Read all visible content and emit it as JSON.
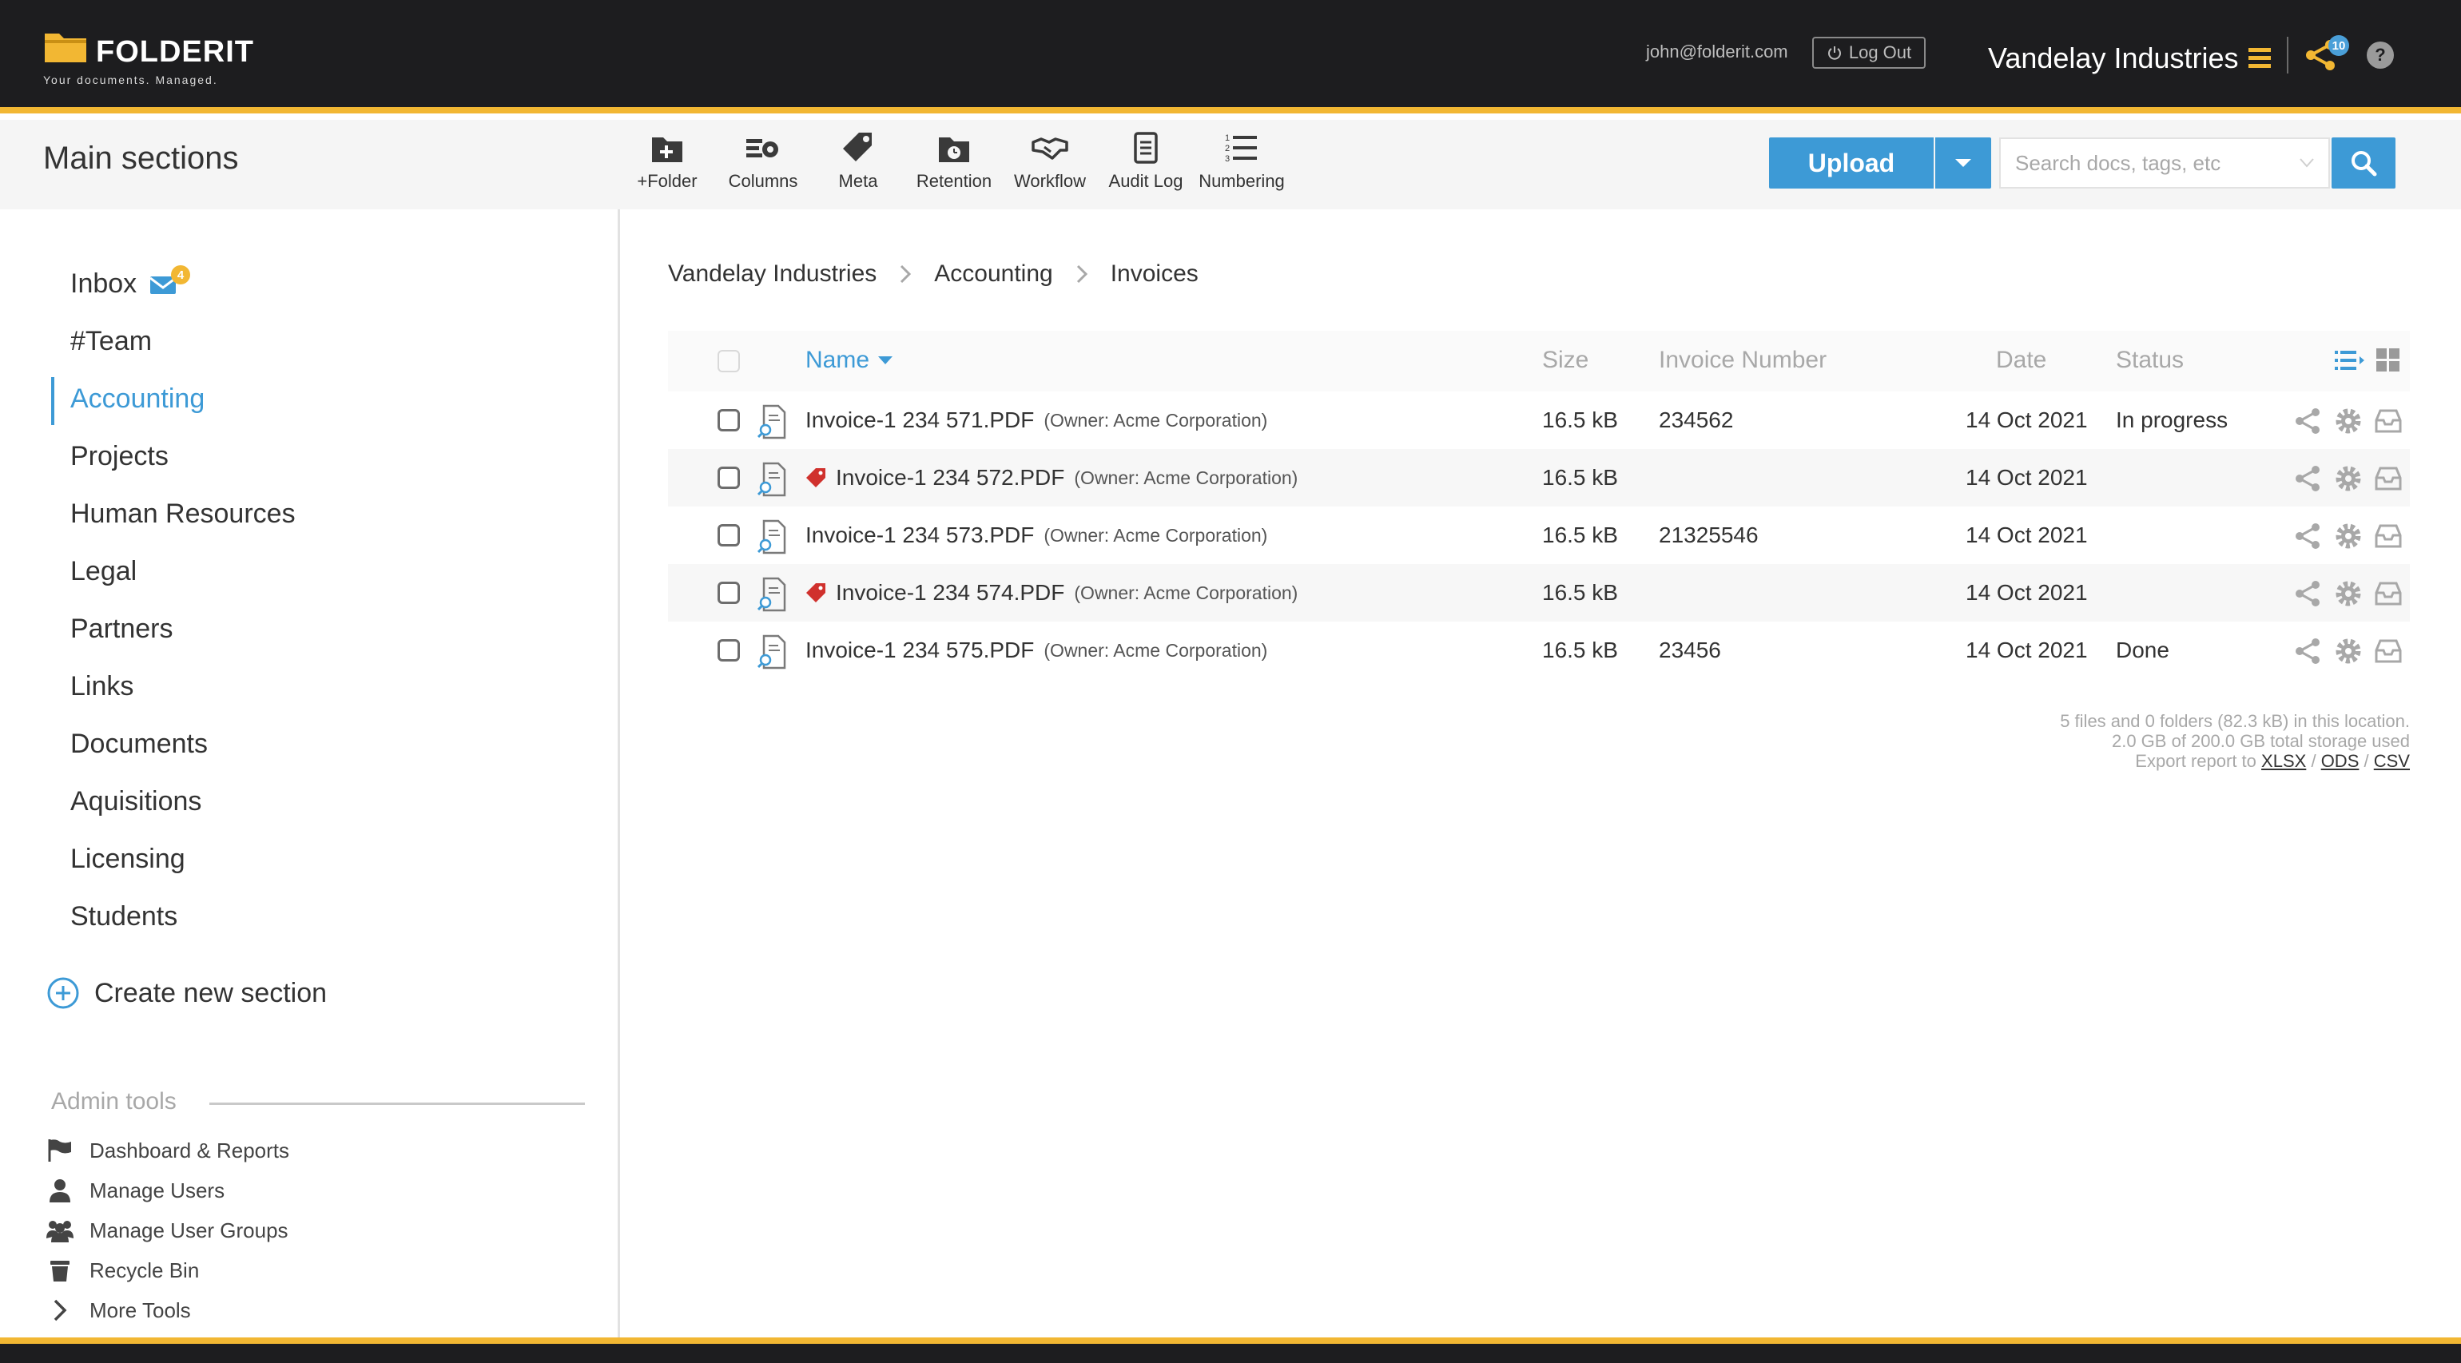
{
  "header": {
    "brand": "FOLDERIT",
    "tagline": "Your documents. Managed.",
    "user_email": "john@folderit.com",
    "logout_label": "Log Out",
    "organization": "Vandelay Industries",
    "share_badge": "10",
    "help_label": "?"
  },
  "toolbar": {
    "section_title": "Main sections",
    "tools": [
      {
        "label": "+Folder",
        "icon": "add-folder-icon"
      },
      {
        "label": "Columns",
        "icon": "columns-settings-icon"
      },
      {
        "label": "Meta",
        "icon": "tag-icon"
      },
      {
        "label": "Retention",
        "icon": "retention-clock-icon"
      },
      {
        "label": "Workflow",
        "icon": "handshake-icon"
      },
      {
        "label": "Audit Log",
        "icon": "audit-log-icon"
      },
      {
        "label": "Numbering",
        "icon": "numbered-list-icon"
      }
    ],
    "upload_label": "Upload",
    "search_placeholder": "Search docs, tags, etc"
  },
  "sidebar": {
    "items": [
      {
        "label": "Inbox",
        "badge": "4"
      },
      {
        "label": "#Team"
      },
      {
        "label": "Accounting",
        "active": true
      },
      {
        "label": "Projects"
      },
      {
        "label": "Human Resources"
      },
      {
        "label": "Legal"
      },
      {
        "label": "Partners"
      },
      {
        "label": "Links"
      },
      {
        "label": "Documents"
      },
      {
        "label": "Aquisitions"
      },
      {
        "label": "Licensing"
      },
      {
        "label": "Students"
      }
    ],
    "create_label": "Create new section",
    "admin_title": "Admin tools",
    "admin_items": [
      {
        "label": "Dashboard & Reports",
        "icon": "flag-icon"
      },
      {
        "label": "Manage Users",
        "icon": "user-icon"
      },
      {
        "label": "Manage User Groups",
        "icon": "user-group-icon"
      },
      {
        "label": "Recycle Bin",
        "icon": "recycle-bin-icon"
      },
      {
        "label": "More Tools",
        "icon": "chevron-right-icon"
      }
    ]
  },
  "breadcrumb": [
    "Vandelay Industries",
    "Accounting",
    "Invoices"
  ],
  "table": {
    "columns": {
      "name": "Name",
      "size": "Size",
      "invoice_number": "Invoice Number",
      "date": "Date",
      "status": "Status"
    },
    "rows": [
      {
        "name": "Invoice-1 234 571.PDF",
        "owner": "(Owner: Acme Corporation)",
        "tagged": false,
        "size": "16.5 kB",
        "invoice_number": "234562",
        "date": "14 Oct 2021",
        "status": "In progress"
      },
      {
        "name": "Invoice-1 234 572.PDF",
        "owner": "(Owner: Acme Corporation)",
        "tagged": true,
        "size": "16.5 kB",
        "invoice_number": "",
        "date": "14 Oct 2021",
        "status": ""
      },
      {
        "name": "Invoice-1 234 573.PDF",
        "owner": "(Owner: Acme Corporation)",
        "tagged": false,
        "size": "16.5 kB",
        "invoice_number": "21325546",
        "date": "14 Oct 2021",
        "status": ""
      },
      {
        "name": "Invoice-1 234 574.PDF",
        "owner": "(Owner: Acme Corporation)",
        "tagged": true,
        "size": "16.5 kB",
        "invoice_number": "",
        "date": "14 Oct 2021",
        "status": ""
      },
      {
        "name": "Invoice-1 234 575.PDF",
        "owner": "(Owner: Acme Corporation)",
        "tagged": false,
        "size": "16.5 kB",
        "invoice_number": "23456",
        "date": "14 Oct 2021",
        "status": "Done"
      }
    ]
  },
  "summary": {
    "line1": "5 files and 0 folders (82.3 kB) in this location.",
    "line2": "2.0 GB of 200.0 GB total storage used",
    "export_prefix": "Export report to",
    "export_formats": [
      "XLSX",
      "ODS",
      "CSV"
    ],
    "export_separator": "/"
  },
  "colors": {
    "accent": "#3d9ad6",
    "brand_yellow": "#f2b733",
    "topbar_bg": "#1d1d1f",
    "tag_red": "#d0312d"
  }
}
